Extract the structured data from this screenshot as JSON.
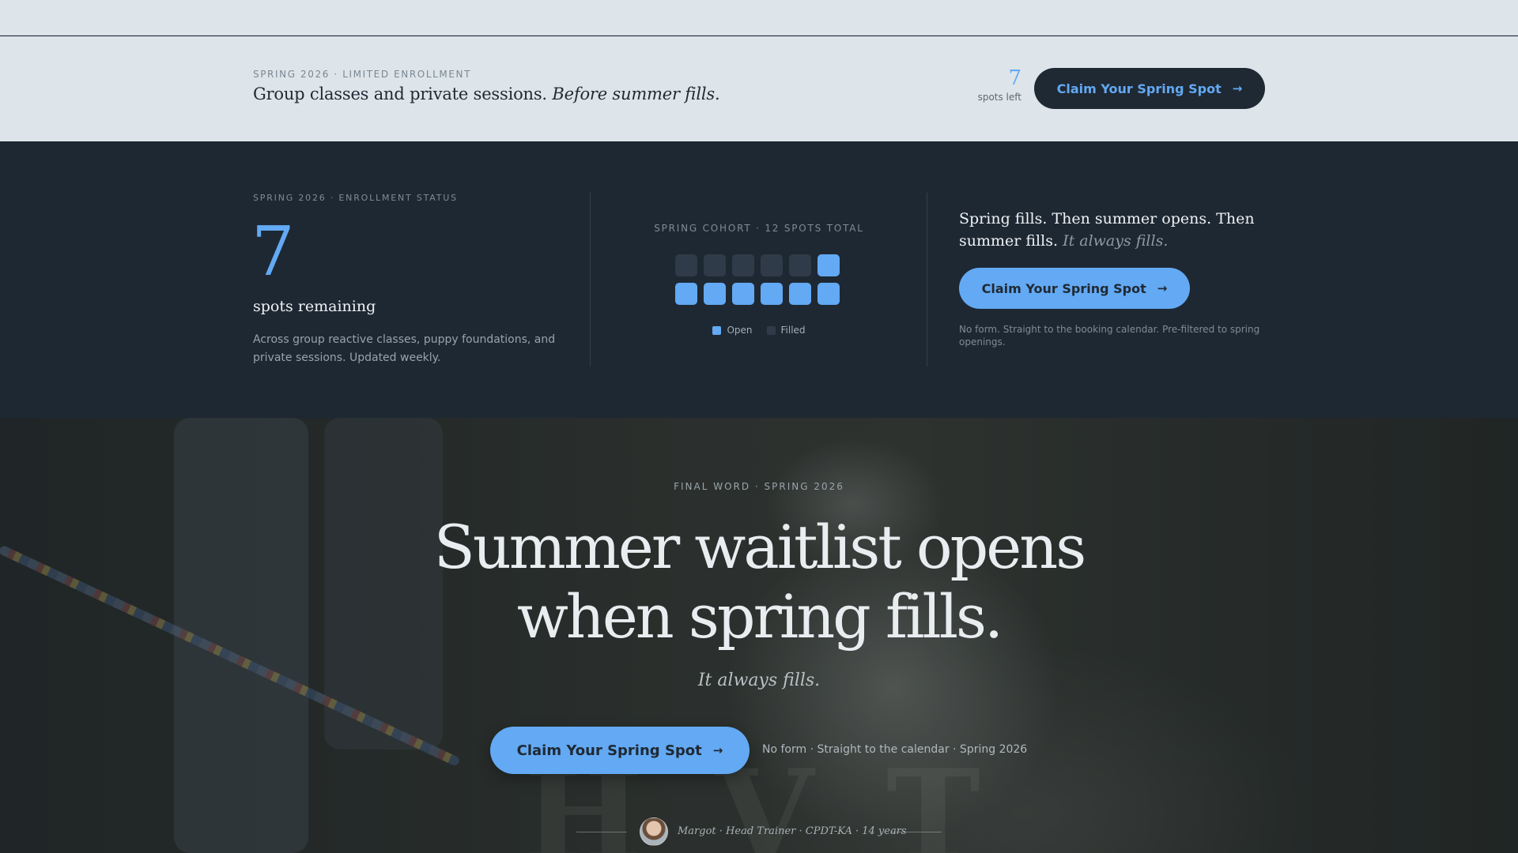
{
  "banner": {
    "eyebrow": "SPRING 2026 · LIMITED ENROLLMENT",
    "headline": "Group classes and private sessions.",
    "headline_em": "Before summer fills.",
    "spots_count": "7",
    "spots_label": "spots left",
    "cta_label": "Claim Your Spring Spot",
    "arrow": "→"
  },
  "status": {
    "eyebrow": "SPRING 2026 · ENROLLMENT STATUS",
    "count": "7",
    "count_label": "spots remaining",
    "description": "Across group reactive classes, puppy foundations, and private sessions. Updated weekly.",
    "cohort": {
      "title": "SPRING COHORT · 12 SPOTS TOTAL",
      "total_spots": 12,
      "open_spots": 7,
      "filled_spots": 5,
      "legend_open": "Open",
      "legend_filled": "Filled",
      "open_color": "#63a9f3",
      "filled_color": "#2f3b48"
    },
    "right_copy": "Spring fills. Then summer opens. Then summer fills.",
    "right_copy_em": "It always fills.",
    "cta_label": "Claim Your Spring Spot",
    "arrow": "→",
    "note": "No form. Straight to the booking calendar. Pre-filtered to spring openings."
  },
  "hero": {
    "eyebrow": "FINAL WORD · SPRING 2026",
    "title_line1": "Summer waitlist opens",
    "title_line2": "when spring fills.",
    "subtitle": "It always fills.",
    "cta_label": "Claim Your Spring Spot",
    "arrow": "→",
    "note": "No form · Straight to the calendar · Spring 2026",
    "signature": "Margot · Head Trainer · CPDT-KA · 14 years"
  },
  "colors": {
    "accent": "#63a9f3",
    "dark": "#1f2933",
    "banner_bg": "#dde5ea"
  }
}
